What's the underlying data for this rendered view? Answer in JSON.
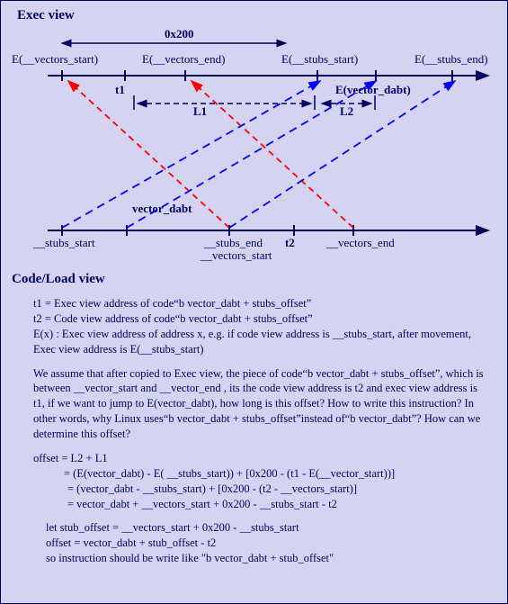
{
  "section_exec": "Exec view",
  "section_code": "Code/Load view",
  "top": {
    "range_label": "0x200",
    "lbl_vec_start_e": "E(__vectors_start)",
    "lbl_vec_end_e": "E(__vectors_end)",
    "lbl_stubs_start_e": "E(__stubs_start)",
    "lbl_stubs_end_e": "E(__stubs_end)",
    "t1": "t1",
    "e_vector_dabt": "E(vector_dabt)",
    "L1": "L1",
    "L2": "L2"
  },
  "mid": {
    "vector_dabt": "vector_dabt"
  },
  "bot": {
    "stubs_start": "__stubs_start",
    "stubs_end": "__stubs_end",
    "vectors_start": "__vectors_start",
    "vectors_end": "__vectors_end",
    "t2": "t2"
  },
  "body": {
    "p1_a": "t1 = Exec view address of code“b vector_dabt + stubs_offset”",
    "p1_b": "t2 = Code view address of code“b vector_dabt + stubs_offset”",
    "p1_c": "E(x) : Exec view address of address x, e.g. if code view address is __stubs_start, after movement, Exec view address is E(__stubs_start)",
    "p2": "We assume that after copied to Exec view, the piece of code“b vector_dabt + stubs_offset”, which is  between __vector_start and __vector_end , its the code view address is t2 and exec view address is t1, if we want to jump to E(vector_dabt), how long is this offset? How to write this instruction?  In other words, why Linux uses“b vector_dabt + stubs_offset”instead of“b vector_dabt”? How can we determine this offset?",
    "eq1": "offset   =   L2 + L1",
    "eq2": " = (E(vector_dabt) - E( __stubs_start)) + [0x200 - (t1 - E(__vector_start))]",
    "eq3": " =  (vector_dabt - __stubs_start) + [0x200 - (t2 - __vectors_start)]",
    "eq4": " =  vector_dabt + __vectors_start + 0x200 - __stubs_start - t2",
    "p4_a": "let  stub_offset =  __vectors_start + 0x200 -  __stubs_start",
    "p4_b": "offset = vector_dabt + stub_offset - t2",
    "p4_c": "so instruction should be write like \"b vector_dabt + stub_offset\""
  }
}
